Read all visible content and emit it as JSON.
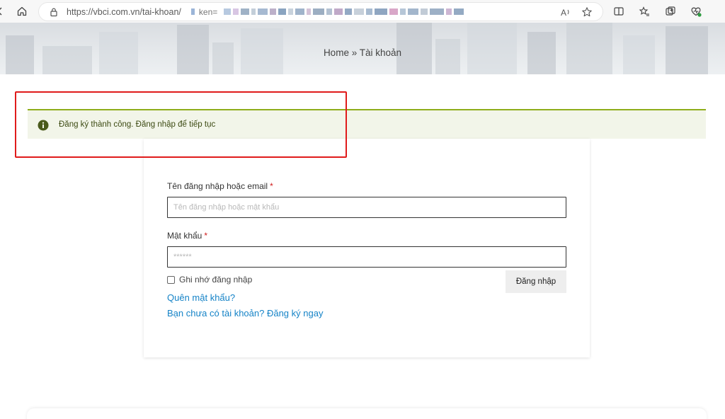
{
  "browser": {
    "url": "https://vbci.com.vn/tai-khoan/",
    "url_tail": "ken=",
    "icons": [
      "back-icon",
      "home-icon",
      "lock-icon",
      "read-aloud-icon",
      "favorite-star-icon",
      "split-screen-icon",
      "favorites-icon",
      "collections-icon",
      "health-icon"
    ]
  },
  "breadcrumb": {
    "home": "Home",
    "separator": "»",
    "current": "Tài khoản"
  },
  "notice": {
    "message": "Đăng ký thành công. Đăng nhập để tiếp tục",
    "accent_color": "#8fae1b"
  },
  "login_form": {
    "username_label": "Tên đăng nhập hoặc email",
    "username_placeholder": "Tên đăng nhập hoặc mật khẩu",
    "password_label": "Mật khẩu",
    "password_placeholder": "******",
    "required_mark": "*",
    "remember_label": "Ghi nhớ đăng nhập",
    "submit_label": "Đăng nhập",
    "forgot_link": "Quên mật khẩu?",
    "register_link": "Bạn chưa có tài khoản? Đăng ký ngay"
  },
  "colors": {
    "link": "#1583c7",
    "required": "#d01c1c",
    "highlight": "#e01b1b"
  }
}
